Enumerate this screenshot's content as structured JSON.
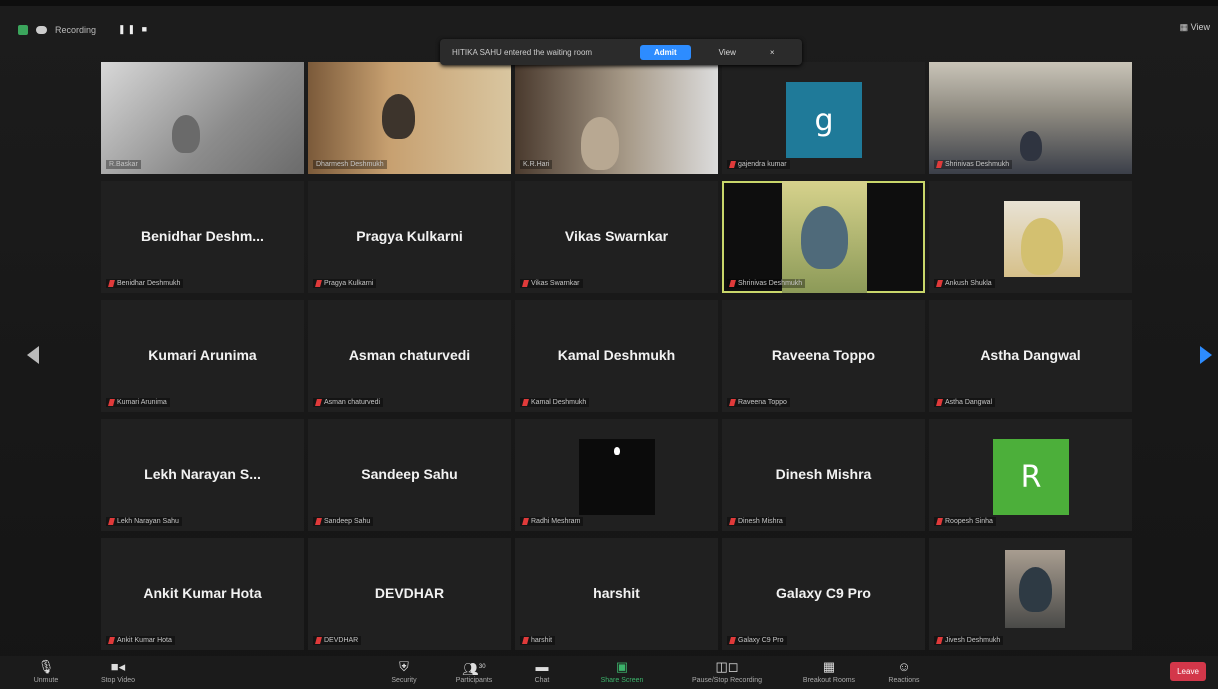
{
  "topbar": {
    "recording_label": "Recording",
    "rec_controls": "❚❚ ■",
    "view_label": "View"
  },
  "notification": {
    "message": "HITIKA SAHU entered the waiting room",
    "admit_label": "Admit",
    "view_label": "View",
    "close_label": "×"
  },
  "tiles": [
    {
      "kind": "video",
      "label": "R.Baskar"
    },
    {
      "kind": "video",
      "label": "Dharmesh Deshmukh"
    },
    {
      "kind": "video",
      "label": "K.R.Hari"
    },
    {
      "kind": "avatar",
      "letter": "g",
      "avatar_color": "#1f7a99",
      "label": "gajendra kumar"
    },
    {
      "kind": "video",
      "label": "Shrinivas Deshmukh"
    },
    {
      "kind": "name",
      "display": "Benidhar Deshm...",
      "label": "Benidhar Deshmukh"
    },
    {
      "kind": "name",
      "display": "Pragya Kulkarni",
      "label": "Pragya Kulkarni"
    },
    {
      "kind": "name",
      "display": "Vikas Swarnkar",
      "label": "Vikas Swarnkar"
    },
    {
      "kind": "video",
      "label": "Shrinivas Deshmukh",
      "highlight": true
    },
    {
      "kind": "video",
      "label": "Ankush Shukla"
    },
    {
      "kind": "name",
      "display": "Kumari Arunima",
      "label": "Kumari Arunima"
    },
    {
      "kind": "name",
      "display": "Asman chaturvedi",
      "label": "Asman chaturvedi"
    },
    {
      "kind": "name",
      "display": "Kamal Deshmukh",
      "label": "Kamal Deshmukh"
    },
    {
      "kind": "name",
      "display": "Raveena Toppo",
      "label": "Raveena Toppo"
    },
    {
      "kind": "name",
      "display": "Astha Dangwal",
      "label": "Astha Dangwal"
    },
    {
      "kind": "name",
      "display": "Lekh Narayan S...",
      "label": "Lekh Narayan Sahu"
    },
    {
      "kind": "name",
      "display": "Sandeep Sahu",
      "label": "Sandeep Sahu"
    },
    {
      "kind": "video",
      "label": "Radhi Meshram"
    },
    {
      "kind": "name",
      "display": "Dinesh Mishra",
      "label": "Dinesh Mishra"
    },
    {
      "kind": "avatar",
      "letter": "R",
      "avatar_color": "#4caf3a",
      "label": "Roopesh Sinha"
    },
    {
      "kind": "name",
      "display": "Ankit Kumar Hota",
      "label": "Ankit Kumar Hota"
    },
    {
      "kind": "name",
      "display": "DEVDHAR",
      "label": "DEVDHAR"
    },
    {
      "kind": "name",
      "display": "harshit",
      "label": "harshit"
    },
    {
      "kind": "name",
      "display": "Galaxy C9 Pro",
      "label": "Galaxy C9 Pro"
    },
    {
      "kind": "video",
      "label": "Jivesh Deshmukh"
    }
  ],
  "toolbar": {
    "unmute": "Unmute",
    "stop_video": "Stop Video",
    "security": "Security",
    "participants": "Participants",
    "participants_count": "30",
    "chat": "Chat",
    "share_screen": "Share Screen",
    "recording": "Pause/Stop Recording",
    "breakout": "Breakout Rooms",
    "reactions": "Reactions",
    "leave": "Leave"
  }
}
